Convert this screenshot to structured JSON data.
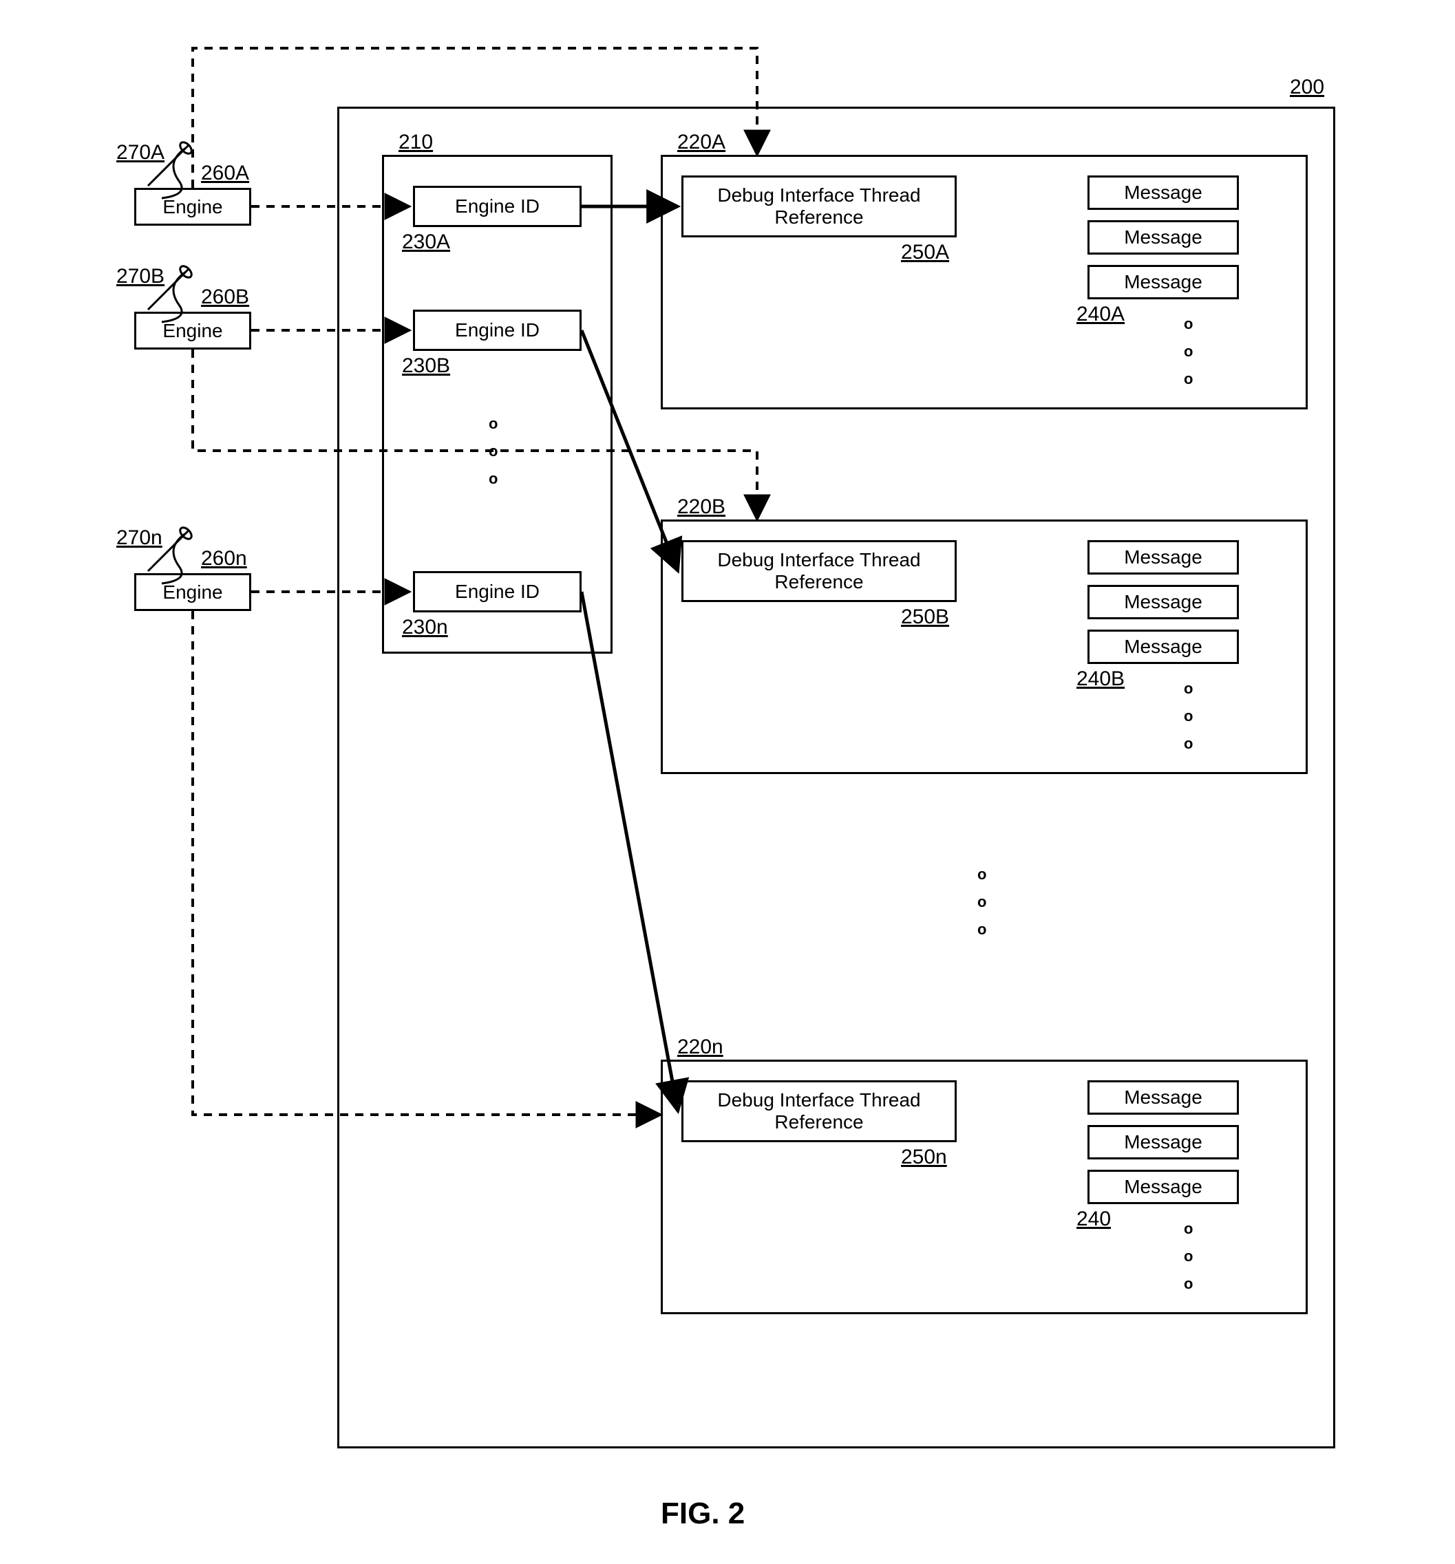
{
  "figure": {
    "caption": "FIG. 2"
  },
  "refs": {
    "outer": "200",
    "table": "210",
    "engineId": {
      "a": "230A",
      "b": "230B",
      "n": "230n"
    },
    "sets": {
      "a": {
        "ref": "220A",
        "thread": "250A",
        "msg": "240A"
      },
      "b": {
        "ref": "220B",
        "thread": "250B",
        "msg": "240B"
      },
      "n": {
        "ref": "220n",
        "thread": "250n",
        "msg": "240"
      }
    },
    "engines": {
      "a": "260A",
      "b": "260B",
      "n": "260n"
    },
    "threads": {
      "a": "270A",
      "b": "270B",
      "n": "270n"
    }
  },
  "text": {
    "engine": "Engine",
    "engineId": "Engine ID",
    "debugRefL1": "Debug Interface Thread",
    "debugRefL2": "Reference",
    "message": "Message"
  }
}
